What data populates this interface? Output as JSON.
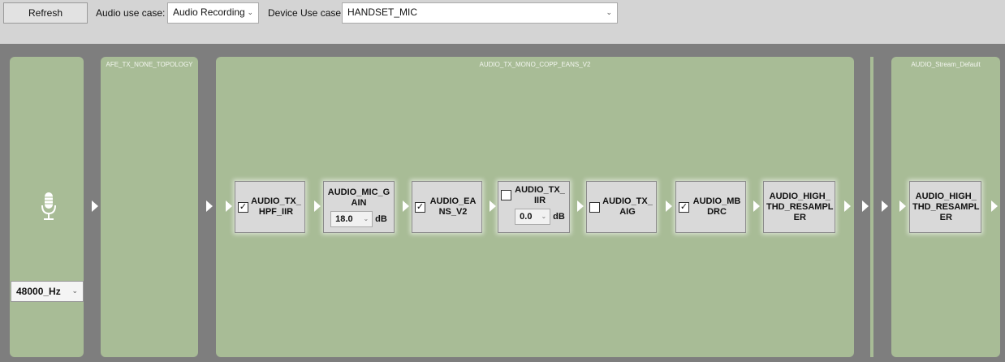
{
  "toolbar": {
    "refresh_label": "Refresh",
    "audio_use_case_label": "Audio use case:",
    "audio_use_case_value": "Audio Recording",
    "device_use_case_label": "Device Use case:",
    "device_use_case_value": "HANDSET_MIC"
  },
  "source": {
    "icon": "microphone-icon",
    "sample_rate": "48000_Hz"
  },
  "panels": {
    "afe": "AFE_TX_NONE_TOPOLOGY",
    "copp": "AUDIO_TX_MONO_COPP_EANS_V2",
    "stream": "AUDIO_Stream_Default"
  },
  "modules": {
    "hpf_iir": {
      "name": "AUDIO_TX_\nHPF_IIR",
      "checked": true
    },
    "mic_gain": {
      "name": "AUDIO_MIC_G\nAIN",
      "value": "18.0",
      "unit": "dB"
    },
    "eans": {
      "name": "AUDIO_EA\nNS_V2",
      "checked": true
    },
    "tx_iir": {
      "name": "AUDIO_TX_\nIIR",
      "checked": false,
      "value": "0.0",
      "unit": "dB"
    },
    "tx_aig": {
      "name": "AUDIO_TX_\nAIG",
      "checked": false
    },
    "mbdrc": {
      "name": "AUDIO_MB\nDRC",
      "checked": true
    },
    "resampler_copp": {
      "name": "AUDIO_HIGH_\nTHD_RESAMPL\nER"
    },
    "resampler_stream": {
      "name": "AUDIO_HIGH_\nTHD_RESAMPL\nER"
    }
  },
  "colors": {
    "panel": "#a8bc96",
    "canvas": "#7e7e7e",
    "toolbar": "#d4d4d4"
  }
}
